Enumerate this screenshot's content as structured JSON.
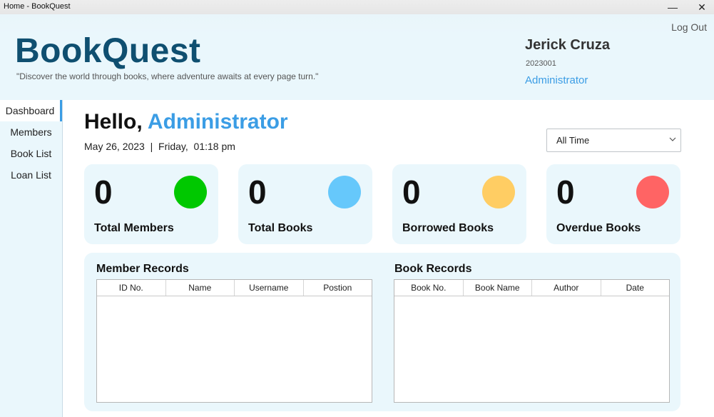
{
  "window": {
    "title": "Home - BookQuest",
    "minimize_glyph": "—",
    "close_glyph": "✕"
  },
  "header": {
    "logout_label": "Log Out",
    "brand": "BookQuest",
    "tagline": "\"Discover the world through books, where adventure awaits at every page turn.\"",
    "user_name": "Jerick Cruza",
    "user_id": "2023001",
    "user_role": "Administrator"
  },
  "sidebar": {
    "items": [
      {
        "label": "Dashboard",
        "active": true
      },
      {
        "label": "Members",
        "active": false
      },
      {
        "label": "Book List",
        "active": false
      },
      {
        "label": "Loan List",
        "active": false
      }
    ]
  },
  "main": {
    "greeting_prefix": "Hello,",
    "greeting_role": "Administrator",
    "datetime": "May 26, 2023  |  Friday,  01:18 pm",
    "filter": {
      "selected": "All Time",
      "chevron": "⌵"
    },
    "cards": [
      {
        "value": "0",
        "label": "Total Members",
        "color": "#00c800"
      },
      {
        "value": "0",
        "label": "Total Books",
        "color": "#66c8fb"
      },
      {
        "value": "0",
        "label": "Borrowed Books",
        "color": "#ffcd63"
      },
      {
        "value": "0",
        "label": "Overdue Books",
        "color": "#ff6464"
      }
    ],
    "member_records": {
      "title": "Member Records",
      "columns": [
        "ID No.",
        "Name",
        "Username",
        "Postion"
      ]
    },
    "book_records": {
      "title": "Book Records",
      "columns": [
        "Book No.",
        "Book Name",
        "Author",
        "Date"
      ]
    }
  },
  "colors": {
    "accent": "#3b9de5",
    "brand": "#0f4f70",
    "panel": "#eaf7fc"
  }
}
